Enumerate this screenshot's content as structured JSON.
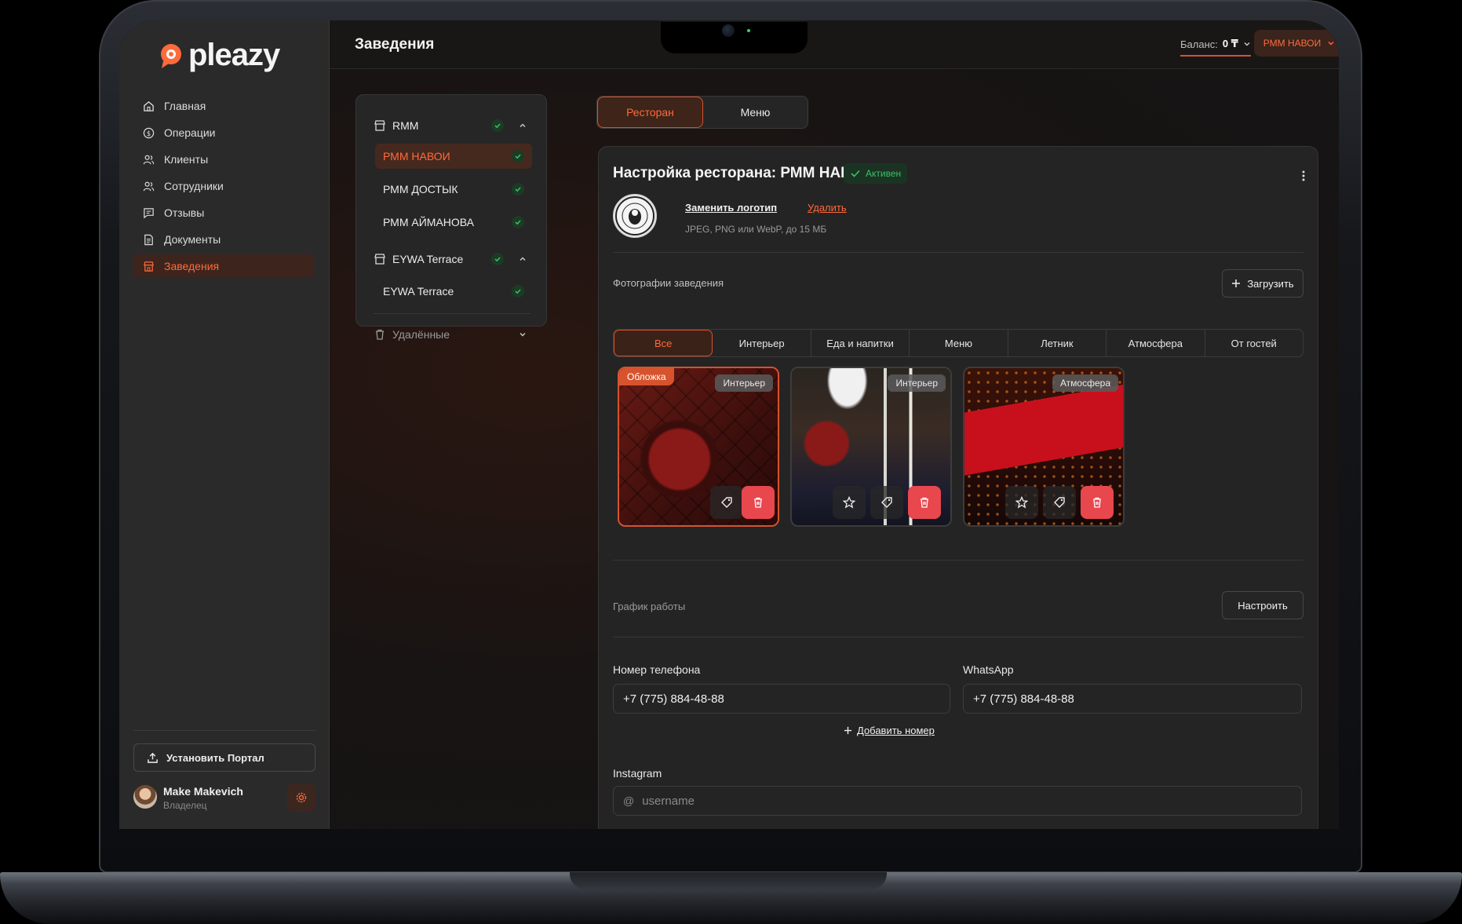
{
  "brand": {
    "name": "pleazy",
    "accent": "#d6532d"
  },
  "sidebar": {
    "items": [
      {
        "label": "Главная",
        "icon": "home-icon"
      },
      {
        "label": "Операции",
        "icon": "dollar-icon"
      },
      {
        "label": "Клиенты",
        "icon": "users-icon"
      },
      {
        "label": "Сотрудники",
        "icon": "team-icon"
      },
      {
        "label": "Отзывы",
        "icon": "message-icon"
      },
      {
        "label": "Документы",
        "icon": "document-icon"
      },
      {
        "label": "Заведения",
        "icon": "store-icon",
        "active": true
      }
    ],
    "install_label": "Установить Портал",
    "user": {
      "name": "Make Makevich",
      "role": "Владелец"
    }
  },
  "header": {
    "title": "Заведения",
    "balance_label": "Баланс:",
    "balance_value": "0 ₸",
    "venue_selected": "РММ НАВОИ"
  },
  "tree": {
    "groups": [
      {
        "name": "RMM",
        "venues": [
          "РММ НАВОИ",
          "РММ ДОСТЫК",
          "РММ АЙМАНОВА"
        ]
      },
      {
        "name": "EYWA Terrace",
        "venues": [
          "EYWA Terrace"
        ]
      }
    ],
    "deleted_label": "Удалённые"
  },
  "main_tabs": [
    "Ресторан",
    "Меню"
  ],
  "card": {
    "title": "Настройка ресторана: РММ НАВОИ",
    "status": "Активен",
    "replace_logo": "Заменить логотип",
    "delete_logo": "Удалить",
    "logo_hint": "JPEG, PNG или WebP, до 15 МБ",
    "photos_label": "Фотографии заведения",
    "upload_label": "Загрузить",
    "filter_tabs": [
      "Все",
      "Интерьер",
      "Еда и напитки",
      "Меню",
      "Летник",
      "Атмосфера",
      "От гостей"
    ],
    "photos": [
      {
        "cover_label": "Обложка",
        "category": "Интерьер"
      },
      {
        "category": "Интерьер"
      },
      {
        "category": "Атмосфера"
      }
    ],
    "schedule_label": "График работы",
    "schedule_button": "Настроить",
    "phone_label": "Номер телефона",
    "phone_value": "+7 (775) 884-48-88",
    "whatsapp_label": "WhatsApp",
    "whatsapp_value": "+7 (775) 884-48-88",
    "add_number": "Добавить номер",
    "instagram_label": "Instagram",
    "instagram_placeholder": "username"
  }
}
